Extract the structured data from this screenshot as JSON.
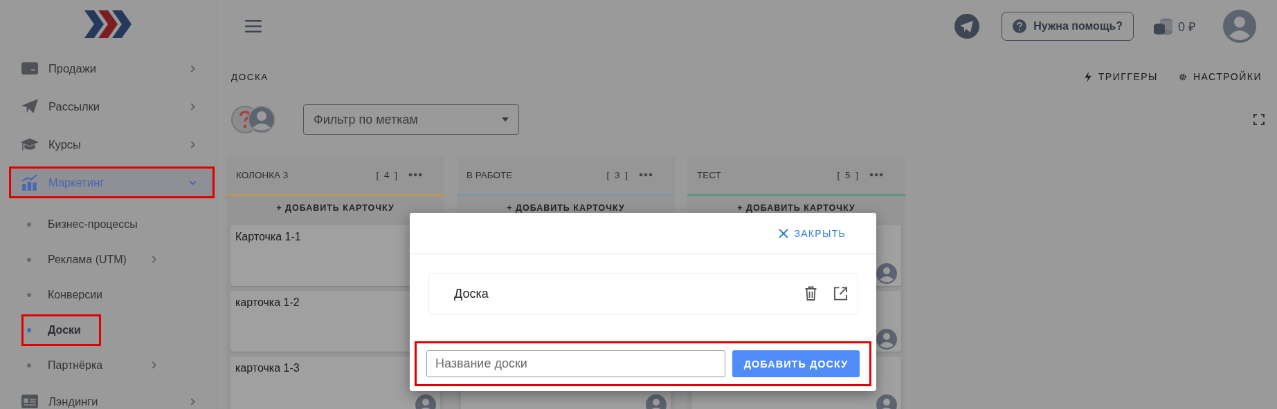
{
  "sidebar": {
    "items": [
      {
        "label": "Продажи",
        "kind": "wallet",
        "expanded": false,
        "selected": false,
        "highlighted": false
      },
      {
        "label": "Рассылки",
        "kind": "plane",
        "expanded": false,
        "selected": false,
        "highlighted": false
      },
      {
        "label": "Курсы",
        "kind": "cap",
        "expanded": false,
        "selected": false,
        "highlighted": false
      },
      {
        "label": "Маркетинг",
        "kind": "chart",
        "expanded": true,
        "selected": true,
        "highlighted": true,
        "children": [
          {
            "label": "Бизнес-процессы",
            "kind": "link",
            "selected": false,
            "highlighted": false
          },
          {
            "label": "Реклама (UTM)",
            "kind": "group",
            "selected": false,
            "highlighted": false
          },
          {
            "label": "Конверсии",
            "kind": "link",
            "selected": false,
            "highlighted": false
          },
          {
            "label": "Доски",
            "kind": "link",
            "selected": true,
            "highlighted": true
          },
          {
            "label": "Партнёрка",
            "kind": "group",
            "selected": false,
            "highlighted": false
          }
        ]
      },
      {
        "label": "Лэндинги",
        "kind": "page",
        "expanded": false,
        "selected": false,
        "highlighted": false
      }
    ]
  },
  "header": {
    "help_button": "Нужна помощь?",
    "balance": "0 ₽"
  },
  "board": {
    "title": "ДОСКА",
    "actions": [
      {
        "label": "ТРИГГЕРЫ",
        "kind": "bolt"
      },
      {
        "label": "НАСТРОЙКИ",
        "kind": "gear"
      }
    ],
    "filter": {
      "placeholder": "Фильтр по меткам"
    },
    "columns": [
      {
        "name": "КОЛОНКА 3",
        "count": "[ 4 ]",
        "color": "#b8955e",
        "add_label": "+ ДОБАВИТЬ КАРТОЧКУ",
        "cards": [
          {
            "kind": "card",
            "title": "Карточка 1-1"
          },
          {
            "kind": "card",
            "title": "карточка 1-2"
          },
          {
            "kind": "card",
            "title": "карточка 1-3",
            "avatar": true
          }
        ]
      },
      {
        "name": "В РАБОТЕ",
        "count": "[ 3 ]",
        "color": "#7f98a8",
        "add_label": "+ ДОБАВИТЬ КАРТОЧКУ",
        "cards": [
          {
            "kind": "covered"
          },
          {
            "kind": "covered"
          },
          {
            "kind": "card",
            "avatar": true
          }
        ]
      },
      {
        "name": "ТЕСТ",
        "count": "[ 5 ]",
        "color": "#5f9585",
        "add_label": "+ ДОБАВИТЬ КАРТОЧКУ",
        "cards": [
          {
            "kind": "card",
            "avatar": true
          },
          {
            "kind": "card",
            "avatar": true
          },
          {
            "kind": "card",
            "avatar": true
          }
        ]
      }
    ]
  },
  "modal": {
    "close_label": "ЗАКРЫТЬ",
    "boards": [
      {
        "name": "Доска"
      }
    ],
    "form": {
      "placeholder": "Название доски",
      "submit": "ДОБАВИТЬ ДОСКУ",
      "highlighted": true
    }
  }
}
